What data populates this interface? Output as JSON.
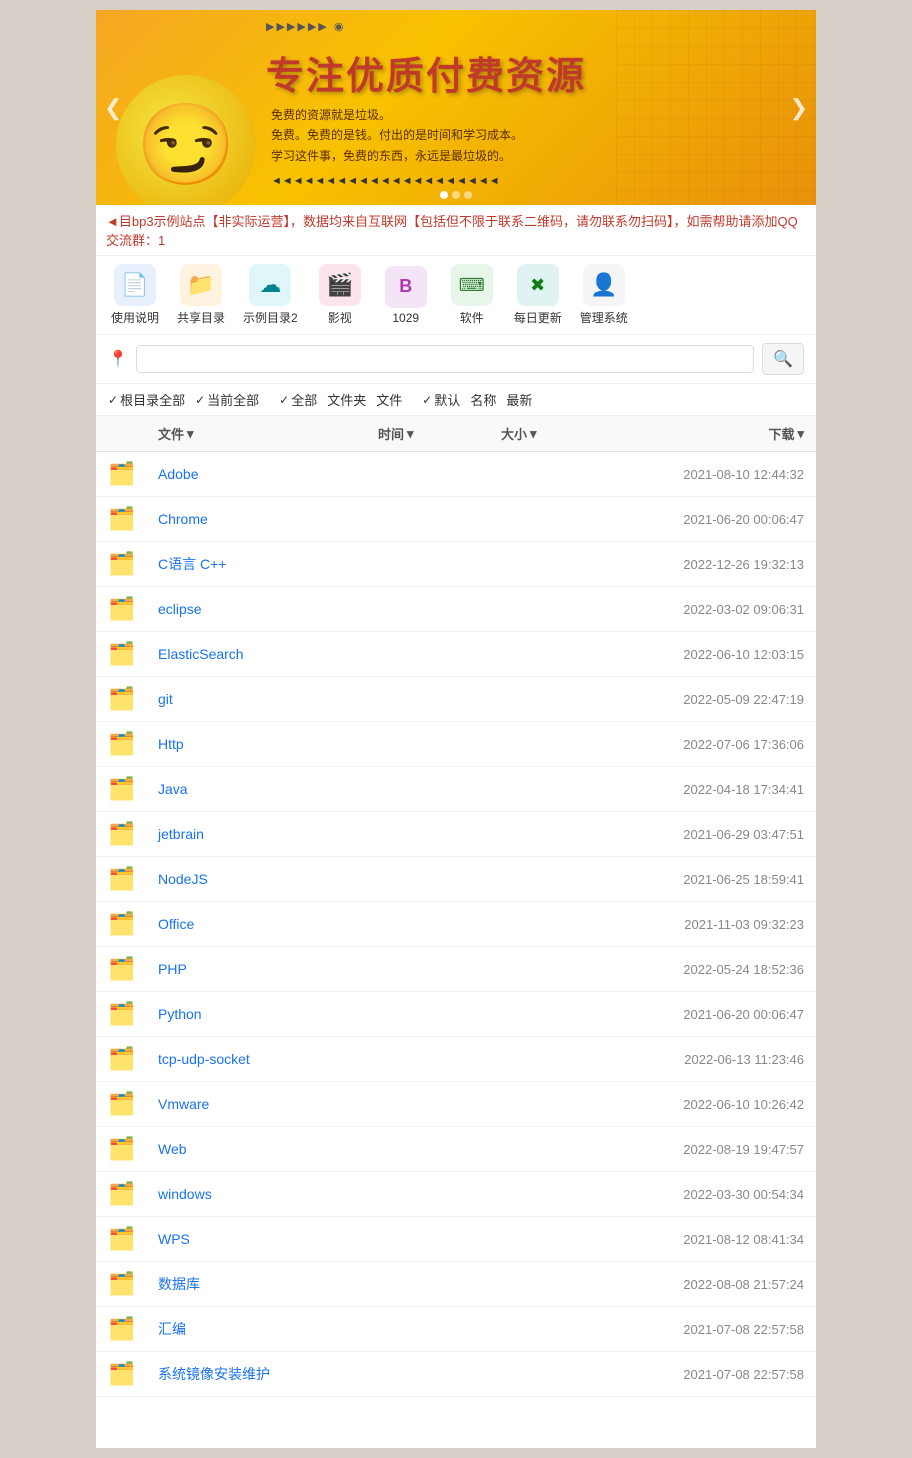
{
  "banner": {
    "title": "专注优质付费资源",
    "lines": [
      "免费的资源就是垃圾。",
      "免费。免费的是钱。付出的是时间和学习成本。",
      "学习这件事，免费的东西，永远是最垃圾的。"
    ],
    "nav_left": "❮",
    "nav_right": "❯"
  },
  "notice": {
    "text": "◄目bp3示例站点【非实际运营】，数据均来自互联网【包括但不限于联系二维码，请勿联系勿扫码】，如需帮助请添加QQ交流群：1"
  },
  "nav_icons": [
    {
      "id": "usage-guide",
      "label": "使用说明",
      "icon": "📄",
      "color": "icon-blue"
    },
    {
      "id": "shared-dir",
      "label": "共享目录",
      "icon": "📂",
      "color": "icon-orange"
    },
    {
      "id": "example-dir2",
      "label": "示例目录2",
      "icon": "☁️",
      "color": "icon-cyan"
    },
    {
      "id": "movies",
      "label": "影视",
      "icon": "🎬",
      "color": "icon-red"
    },
    {
      "id": "1029",
      "label": "1029",
      "icon": "🅱",
      "color": "icon-purple"
    },
    {
      "id": "software",
      "label": "软件",
      "icon": "⌨",
      "color": "icon-green"
    },
    {
      "id": "daily-update",
      "label": "每日更新",
      "icon": "✖",
      "color": "icon-teal"
    },
    {
      "id": "management",
      "label": "管理系统",
      "icon": "👤",
      "color": "icon-gray"
    }
  ],
  "search": {
    "placeholder": "",
    "pin_icon": "📍",
    "button_icon": "🔍"
  },
  "filters": {
    "scope": [
      {
        "label": "根目录全部",
        "active": true
      },
      {
        "label": "当前全部",
        "active": true
      }
    ],
    "type": [
      {
        "label": "全部",
        "active": true
      },
      {
        "label": "文件夹",
        "active": false
      },
      {
        "label": "文件",
        "active": false
      }
    ],
    "sort": [
      {
        "label": "默认",
        "active": true
      },
      {
        "label": "名称",
        "active": false
      },
      {
        "label": "最新",
        "active": false
      }
    ]
  },
  "table_header": {
    "col_file": "文件",
    "col_time": "时间",
    "col_size": "大小",
    "col_download": "下载"
  },
  "files": [
    {
      "name": "Adobe",
      "time": "2021-08-10 12:44:32",
      "size": "",
      "download": ""
    },
    {
      "name": "Chrome",
      "time": "2021-06-20 00:06:47",
      "size": "",
      "download": ""
    },
    {
      "name": "C语言 C++",
      "time": "2022-12-26 19:32:13",
      "size": "",
      "download": ""
    },
    {
      "name": "eclipse",
      "time": "2022-03-02 09:06:31",
      "size": "",
      "download": ""
    },
    {
      "name": "ElasticSearch",
      "time": "2022-06-10 12:03:15",
      "size": "",
      "download": ""
    },
    {
      "name": "git",
      "time": "2022-05-09 22:47:19",
      "size": "",
      "download": ""
    },
    {
      "name": "Http",
      "time": "2022-07-06 17:36:06",
      "size": "",
      "download": ""
    },
    {
      "name": "Java",
      "time": "2022-04-18 17:34:41",
      "size": "",
      "download": ""
    },
    {
      "name": "jetbrain",
      "time": "2021-06-29 03:47:51",
      "size": "",
      "download": ""
    },
    {
      "name": "NodeJS",
      "time": "2021-06-25 18:59:41",
      "size": "",
      "download": ""
    },
    {
      "name": "Office",
      "time": "2021-11-03 09:32:23",
      "size": "",
      "download": ""
    },
    {
      "name": "PHP",
      "time": "2022-05-24 18:52:36",
      "size": "",
      "download": ""
    },
    {
      "name": "Python",
      "time": "2021-06-20 00:06:47",
      "size": "",
      "download": ""
    },
    {
      "name": "tcp-udp-socket",
      "time": "2022-06-13 11:23:46",
      "size": "",
      "download": ""
    },
    {
      "name": "Vmware",
      "time": "2022-06-10 10:26:42",
      "size": "",
      "download": ""
    },
    {
      "name": "Web",
      "time": "2022-08-19 19:47:57",
      "size": "",
      "download": ""
    },
    {
      "name": "windows",
      "time": "2022-03-30 00:54:34",
      "size": "",
      "download": ""
    },
    {
      "name": "WPS",
      "time": "2021-08-12 08:41:34",
      "size": "",
      "download": ""
    },
    {
      "name": "数据库",
      "time": "2022-08-08 21:57:24",
      "size": "",
      "download": ""
    },
    {
      "name": "汇编",
      "time": "2021-07-08 22:57:58",
      "size": "",
      "download": ""
    },
    {
      "name": "系统镜像安装维护",
      "time": "2021-07-08 22:57:58",
      "size": "",
      "download": ""
    }
  ],
  "colors": {
    "link": "#1a73e8",
    "time": "#888888",
    "accent": "#f5a623",
    "notice_red": "#c0392b"
  }
}
